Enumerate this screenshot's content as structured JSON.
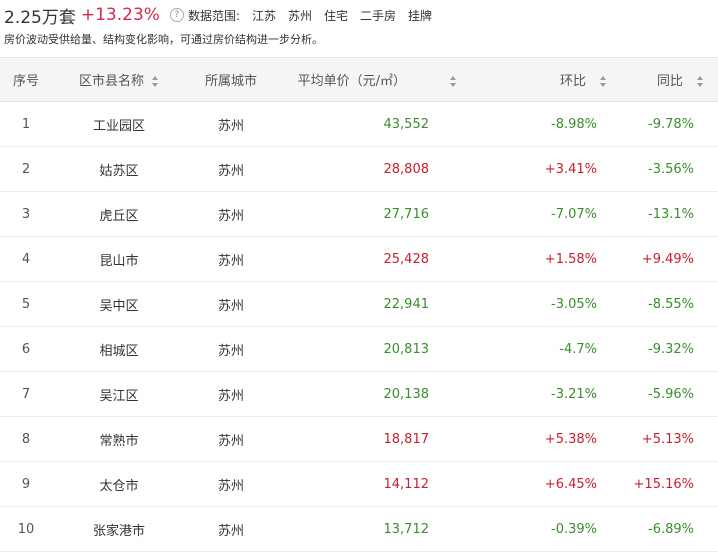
{
  "header": {
    "total": "2.25万套",
    "change": "+13.23%",
    "range_label": "数据范围:",
    "range_tags": [
      "江苏",
      "苏州",
      "住宅",
      "二手房",
      "挂牌"
    ]
  },
  "note": "房价波动受供给量、结构变化影响，可通过房价结构进一步分析。",
  "table": {
    "columns": [
      "序号",
      "区市县名称",
      "所属城市",
      "平均单价（元/㎡）",
      "环比",
      "同比"
    ],
    "rows": [
      {
        "rank": "1",
        "name": "工业园区",
        "city": "苏州",
        "price": "43,552",
        "price_dir": "down",
        "hb": "-8.98%",
        "hb_dir": "down",
        "tb": "-9.78%",
        "tb_dir": "down"
      },
      {
        "rank": "2",
        "name": "姑苏区",
        "city": "苏州",
        "price": "28,808",
        "price_dir": "up",
        "hb": "+3.41%",
        "hb_dir": "up",
        "tb": "-3.56%",
        "tb_dir": "down"
      },
      {
        "rank": "3",
        "name": "虎丘区",
        "city": "苏州",
        "price": "27,716",
        "price_dir": "down",
        "hb": "-7.07%",
        "hb_dir": "down",
        "tb": "-13.1%",
        "tb_dir": "down"
      },
      {
        "rank": "4",
        "name": "昆山市",
        "city": "苏州",
        "price": "25,428",
        "price_dir": "up",
        "hb": "+1.58%",
        "hb_dir": "up",
        "tb": "+9.49%",
        "tb_dir": "up"
      },
      {
        "rank": "5",
        "name": "吴中区",
        "city": "苏州",
        "price": "22,941",
        "price_dir": "down",
        "hb": "-3.05%",
        "hb_dir": "down",
        "tb": "-8.55%",
        "tb_dir": "down"
      },
      {
        "rank": "6",
        "name": "相城区",
        "city": "苏州",
        "price": "20,813",
        "price_dir": "down",
        "hb": "-4.7%",
        "hb_dir": "down",
        "tb": "-9.32%",
        "tb_dir": "down"
      },
      {
        "rank": "7",
        "name": "吴江区",
        "city": "苏州",
        "price": "20,138",
        "price_dir": "down",
        "hb": "-3.21%",
        "hb_dir": "down",
        "tb": "-5.96%",
        "tb_dir": "down"
      },
      {
        "rank": "8",
        "name": "常熟市",
        "city": "苏州",
        "price": "18,817",
        "price_dir": "up",
        "hb": "+5.38%",
        "hb_dir": "up",
        "tb": "+5.13%",
        "tb_dir": "up"
      },
      {
        "rank": "9",
        "name": "太仓市",
        "city": "苏州",
        "price": "14,112",
        "price_dir": "up",
        "hb": "+6.45%",
        "hb_dir": "up",
        "tb": "+15.16%",
        "tb_dir": "up"
      },
      {
        "rank": "10",
        "name": "张家港市",
        "city": "苏州",
        "price": "13,712",
        "price_dir": "down",
        "hb": "-0.39%",
        "hb_dir": "down",
        "tb": "-6.89%",
        "tb_dir": "down"
      }
    ]
  },
  "colors": {
    "up": "#c8202f",
    "down": "#3b8d2e"
  }
}
